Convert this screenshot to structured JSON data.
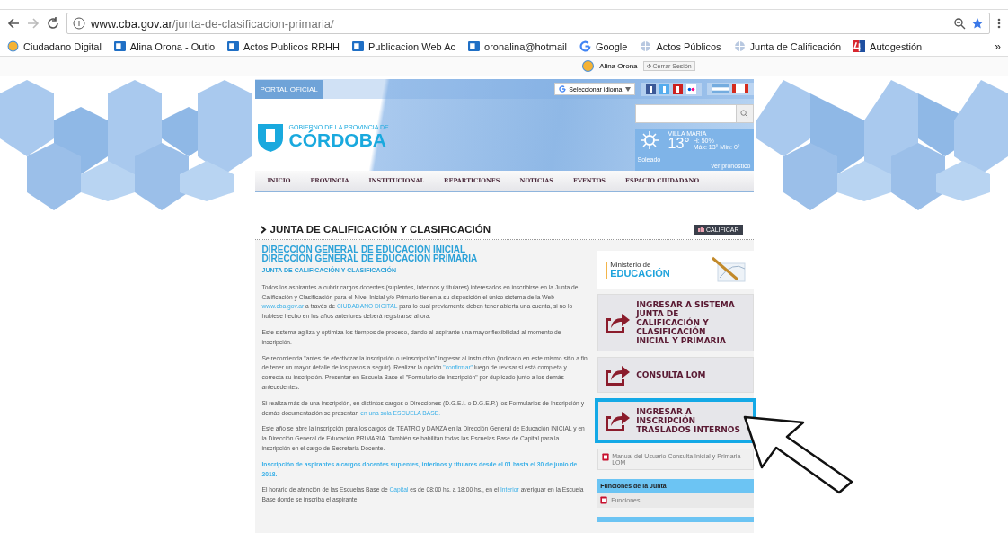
{
  "browser": {
    "url_domain": "www.cba.gov.ar",
    "url_path": "/junta-de-clasificacion-primaria/",
    "overflow": "»",
    "bookmarks": [
      {
        "kind": "circle",
        "label": "Ciudadano Digital"
      },
      {
        "kind": "outlook",
        "label": "Alina Orona - Outlo"
      },
      {
        "kind": "outlook",
        "label": "Actos Publicos RRHH"
      },
      {
        "kind": "outlook",
        "label": "Publicacion Web Ac"
      },
      {
        "kind": "outlook",
        "label": "oronalina@hotmail"
      },
      {
        "kind": "google",
        "label": "Google"
      },
      {
        "kind": "globe",
        "label": "Actos Públicos"
      },
      {
        "kind": "globe",
        "label": "Junta de Calificación"
      },
      {
        "kind": "four",
        "label": "Autogestión"
      }
    ]
  },
  "user_bar": {
    "name": "Alina Orona",
    "logout": "Cerrar Sesión"
  },
  "header": {
    "portal": "PORTAL OFICIAL",
    "language": "Seleccionar idioma",
    "logo_top": "GOBIERNO DE LA PROVINCIA DE",
    "logo_main": "CÓRDOBA",
    "weather": {
      "city": "VILLA MARIA",
      "temp": "13°",
      "humidity": "H: 50%",
      "range": "Máx: 13° Mín: 0°",
      "link": "ver pronóstico",
      "condition": "Soleado"
    }
  },
  "nav": [
    "INICIO",
    "PROVINCIA",
    "INSTITUCIONAL",
    "REPARTICIONES",
    "NOTICIAS",
    "EVENTOS",
    "ESPACIO CIUDADANO"
  ],
  "title": "JUNTA DE CALIFICACIÓN Y CLASIFICACIÓN",
  "rate_button": "CALIFICAR",
  "main": {
    "headings": [
      "DIRECCIÓN GENERAL DE EDUCACIÓN INICIAL",
      "DIRECCIÓN GENERAL DE EDUCACIÓN PRIMARIA"
    ],
    "subheading": "JUNTA DE CALIFICACIÓN Y CLASIFICACIÓN",
    "paragraphs": [
      {
        "kind": "text",
        "parts": [
          {
            "text": "Todos los aspirantes a cubrir cargos docentes (suplentes, interinos y titulares) interesados en inscribirse en la Junta de Calificación y Clasificación para el Nivel Inicial y/o Primario tienen a su disposición el único sistema de la Web ",
            "link": false
          },
          {
            "text": "www.cba.gov.ar",
            "link": true
          },
          {
            "text": " a través de ",
            "link": false
          },
          {
            "text": "CIUDADANO DIGITAL",
            "link": true
          },
          {
            "text": " para lo cual previamente deben tener abierta una cuenta, si no lo hubiese hecho en los años anteriores deberá registrarse ahora.",
            "link": false
          }
        ]
      },
      {
        "kind": "text",
        "parts": [
          {
            "text": "Este sistema agiliza y optimiza los tiempos de proceso, dando al aspirante una mayor flexibilidad al momento de inscripción.",
            "link": false
          }
        ]
      },
      {
        "kind": "text",
        "parts": [
          {
            "text": "Se recomienda \"antes de efectivizar la inscripción o reinscripción\" ingresar al instructivo (indicado en este mismo sitio a fin de tener un mayor detalle de los pasos a seguir). Realizar la opción ",
            "link": false
          },
          {
            "text": "\"confirmar\"",
            "link": true
          },
          {
            "text": " luego de revisar si está completa y correcta su inscripción. Presentar en Escuela Base el \"Formulario de Inscripción\" por duplicado junto a los demás antecedentes.",
            "link": false
          }
        ]
      },
      {
        "kind": "text",
        "parts": [
          {
            "text": "Si realiza más de una inscripción, en distintos cargos o Direcciones (D.G.E.I. o D.G.E.P.) los Formularios de Inscripción y demás documentación se presentan ",
            "link": false
          },
          {
            "text": "en una sola ESCUELA BASE.",
            "link": true
          }
        ]
      },
      {
        "kind": "text",
        "parts": [
          {
            "text": "Este año se abre la inscripción para los cargos de TEATRO y DANZA en la Dirección General de Educación INICIAL y en la Dirección General de Educación PRIMARIA. También se habilitan todas las Escuelas Base de Capital para la inscripción en el cargo de Secretaria Docente.",
            "link": false
          }
        ]
      },
      {
        "kind": "notice",
        "parts": [
          {
            "text": "Inscripción de aspirantes a cargos docentes suplentes, interinos y titulares desde el 01 hasta el 30 de junio de 2018.",
            "link": false
          }
        ]
      },
      {
        "kind": "text",
        "parts": [
          {
            "text": "El horario de atención de las Escuelas Base de ",
            "link": false
          },
          {
            "text": "Capital",
            "link": true
          },
          {
            "text": " es de 08:00 hs. a 18:00 hs., en el ",
            "link": false
          },
          {
            "text": "Interior",
            "link": true
          },
          {
            "text": " averiguar en la Escuela Base donde se inscriba el aspirante.",
            "link": false
          }
        ]
      }
    ]
  },
  "sidebar": {
    "ministry": [
      "Ministerio de",
      "EDUCACIÓN"
    ],
    "actions": [
      {
        "label": "INGRESAR A SISTEMA\nJUNTA DE\nCALIFICACIÓN Y\nCLASIFICACIÓN\nINICIAL Y PRIMARIA",
        "highlighted": false
      },
      {
        "label": "CONSULTA LOM",
        "highlighted": false
      },
      {
        "label": "INGRESAR A\nINSCRIPCIÓN\nTRASLADOS INTERNOS",
        "highlighted": true
      }
    ],
    "documents": [
      "Manual del Usuario Consulta Inicial y Primaria LOM"
    ],
    "functions": {
      "title": "Funciones de la Junta",
      "items": [
        "Funciones"
      ]
    }
  }
}
